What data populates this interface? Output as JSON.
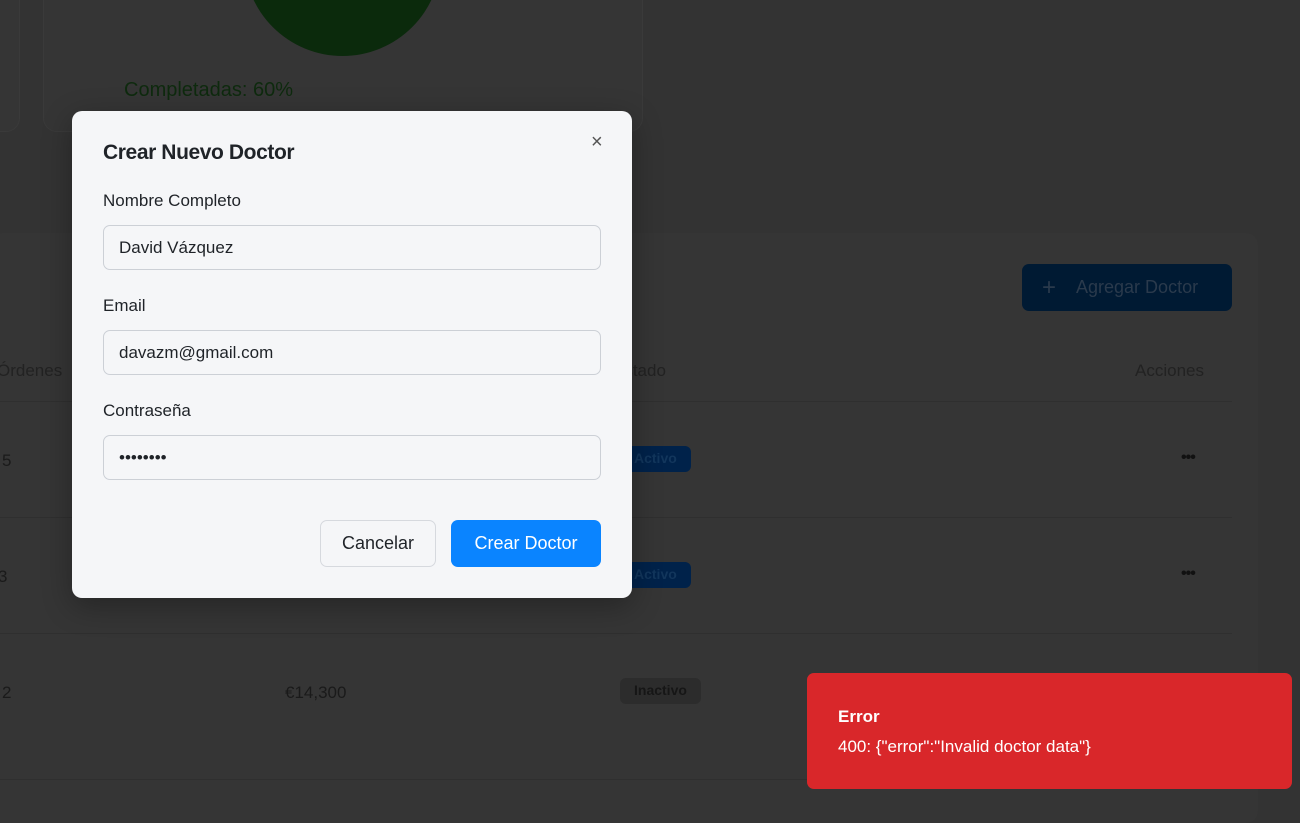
{
  "chart": {
    "label": "Completadas: 60%",
    "color": "#0b2a0c"
  },
  "table": {
    "add_button": "Agregar Doctor",
    "headers": {
      "orders": "Órdenes",
      "status": "Estado",
      "actions": "Acciones"
    },
    "rows": [
      {
        "orders": "5",
        "revenue": "",
        "status": "Activo"
      },
      {
        "orders": "3",
        "revenue": "",
        "status": "Activo"
      },
      {
        "orders": "2",
        "revenue": "€14,300",
        "status": "Inactivo"
      }
    ],
    "actions_icon": "•••"
  },
  "modal": {
    "title": "Crear Nuevo Doctor",
    "name_label": "Nombre Completo",
    "name_value": "David Vázquez",
    "email_label": "Email",
    "email_value": "davazm@gmail.com",
    "password_label": "Contraseña",
    "password_value": "password",
    "cancel": "Cancelar",
    "submit": "Crear Doctor",
    "close_icon": "×"
  },
  "toast": {
    "title": "Error",
    "message": "400: {\"error\":\"Invalid doctor data\"}",
    "color": "#d9272a"
  }
}
